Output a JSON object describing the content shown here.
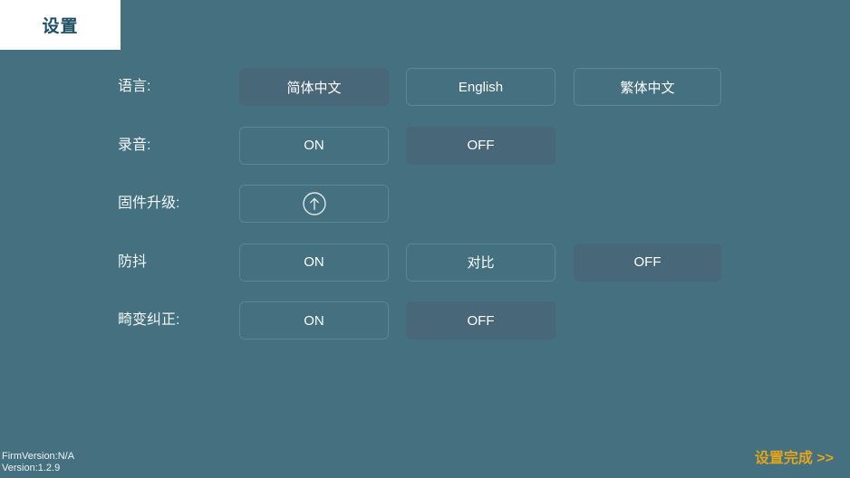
{
  "colors": {
    "background": "#44707f",
    "tab_background": "#ffffff",
    "tab_text": "#1e4f64",
    "button_border": "#5d8593",
    "button_selected_fill": "#48687a",
    "text": "#ffffff",
    "done_link": "#e3a51c"
  },
  "tab": {
    "label": "设置"
  },
  "settings": {
    "rows": [
      {
        "name": "language",
        "label": "语言:",
        "options": [
          {
            "label": "简体中文",
            "selected": true
          },
          {
            "label": "English",
            "selected": false
          },
          {
            "label": "繁体中文",
            "selected": false
          }
        ]
      },
      {
        "name": "recording",
        "label": "录音:",
        "options": [
          {
            "label": "ON",
            "selected": false
          },
          {
            "label": "OFF",
            "selected": true
          }
        ]
      },
      {
        "name": "firmware-upgrade",
        "label": "固件升级:",
        "options": [
          {
            "label": "",
            "icon": "upload-arrow-circle-icon",
            "selected": false
          }
        ]
      },
      {
        "name": "anti-shake",
        "label": "防抖",
        "options": [
          {
            "label": "ON",
            "selected": false
          },
          {
            "label": "对比",
            "selected": false
          },
          {
            "label": "OFF",
            "selected": true
          }
        ]
      },
      {
        "name": "distortion-correction",
        "label": "畸变纠正:",
        "options": [
          {
            "label": "ON",
            "selected": false
          },
          {
            "label": "OFF",
            "selected": true
          }
        ]
      }
    ]
  },
  "footer": {
    "firm_version": "FirmVersion:N/A",
    "version": "Version:1.2.9",
    "done_label": "设置完成 >>"
  }
}
